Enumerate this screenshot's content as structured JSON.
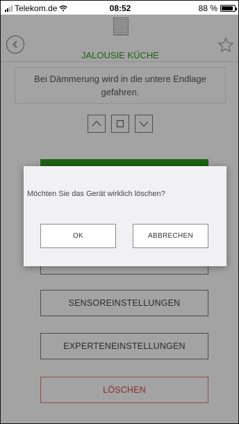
{
  "status": {
    "carrier": "Telekom.de",
    "time": "08:52",
    "battery": "88 %",
    "battery_level": 0.88
  },
  "header": {
    "title": "JALOUSIE KÜCHE",
    "icons": {
      "back": "back-circle-icon",
      "favorite": "star-outline-icon",
      "device": "blind-icon"
    }
  },
  "info": {
    "text": "Bei Dämmerung wird in die untere Endlage gefahren."
  },
  "controls": {
    "icons": [
      "chevron-up-icon",
      "stop-square-icon",
      "chevron-down-icon"
    ]
  },
  "buttons": {
    "sensor": "SENSOREINSTELLUNGEN",
    "expert": "EXPERTENEINSTELLUNGEN",
    "delete": "LÖSCHEN"
  },
  "dialog": {
    "message": "Möchten Sie das Gerät wirklich löschen?",
    "ok": "OK",
    "cancel": "ABBRECHEN"
  },
  "colors": {
    "accent_green": "#2d9a1f",
    "delete_red": "#d44444",
    "dialog_bg": "#f1f1f4"
  }
}
